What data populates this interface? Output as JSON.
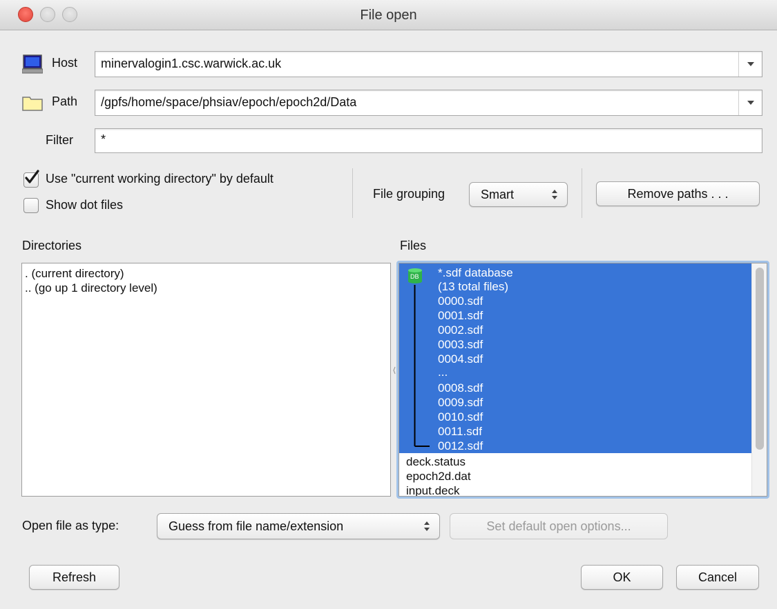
{
  "window": {
    "title": "File open"
  },
  "host": {
    "label": "Host",
    "value": "minervalogin1.csc.warwick.ac.uk"
  },
  "path": {
    "label": "Path",
    "value": "/gpfs/home/space/phsiav/epoch/epoch2d/Data"
  },
  "filter": {
    "label": "Filter",
    "value": "*"
  },
  "options": {
    "use_cwd": {
      "label": "Use \"current working directory\" by default",
      "checked": true
    },
    "show_dot": {
      "label": "Show dot files",
      "checked": false
    }
  },
  "grouping": {
    "label": "File grouping",
    "value": "Smart"
  },
  "remove_paths": {
    "label": "Remove paths . . ."
  },
  "directories": {
    "label": "Directories",
    "items": [
      ". (current directory)",
      ".. (go up 1 directory level)"
    ]
  },
  "files": {
    "label": "Files",
    "database_icon_text": "DB",
    "group": {
      "title": "*.sdf database",
      "count": "(13 total files)",
      "items": [
        "0000.sdf",
        "0001.sdf",
        "0002.sdf",
        "0003.sdf",
        "0004.sdf",
        "...",
        "0008.sdf",
        "0009.sdf",
        "0010.sdf",
        "0011.sdf",
        "0012.sdf"
      ]
    },
    "other": [
      "deck.status",
      "epoch2d.dat",
      "input.deck"
    ]
  },
  "open_type": {
    "label": "Open file as type:",
    "value": "Guess from file name/extension"
  },
  "default_options": {
    "label": "Set default open options..."
  },
  "buttons": {
    "refresh": "Refresh",
    "ok": "OK",
    "cancel": "Cancel"
  },
  "colors": {
    "selection": "#3875d7",
    "close_button": "#e0443a"
  }
}
